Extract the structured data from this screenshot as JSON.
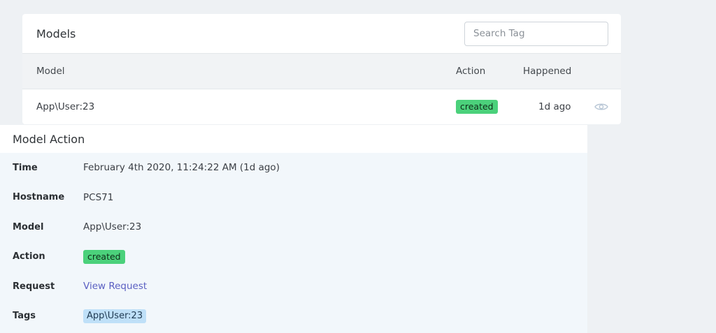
{
  "models": {
    "title": "Models",
    "search_placeholder": "Search Tag",
    "columns": {
      "model": "Model",
      "action": "Action",
      "happened": "Happened"
    },
    "rows": [
      {
        "model": "App\\User:23",
        "action": "created",
        "happened": "1d ago",
        "view_icon": "eye-icon"
      }
    ]
  },
  "model_action": {
    "title": "Model Action",
    "fields": {
      "time_label": "Time",
      "time_value": "February 4th 2020, 11:24:22 AM (1d ago)",
      "hostname_label": "Hostname",
      "hostname_value": "PCS71",
      "model_label": "Model",
      "model_value": "App\\User:23",
      "action_label": "Action",
      "action_value": "created",
      "request_label": "Request",
      "request_value": "View Request",
      "tags_label": "Tags",
      "tags_value": "App\\User:23"
    }
  },
  "colors": {
    "created_badge": "#4bd17b",
    "tag_badge": "#bfe0f8",
    "link": "#5a5fc2",
    "page_background": "#eef1f4",
    "panel_background": "#f2f7fb"
  }
}
